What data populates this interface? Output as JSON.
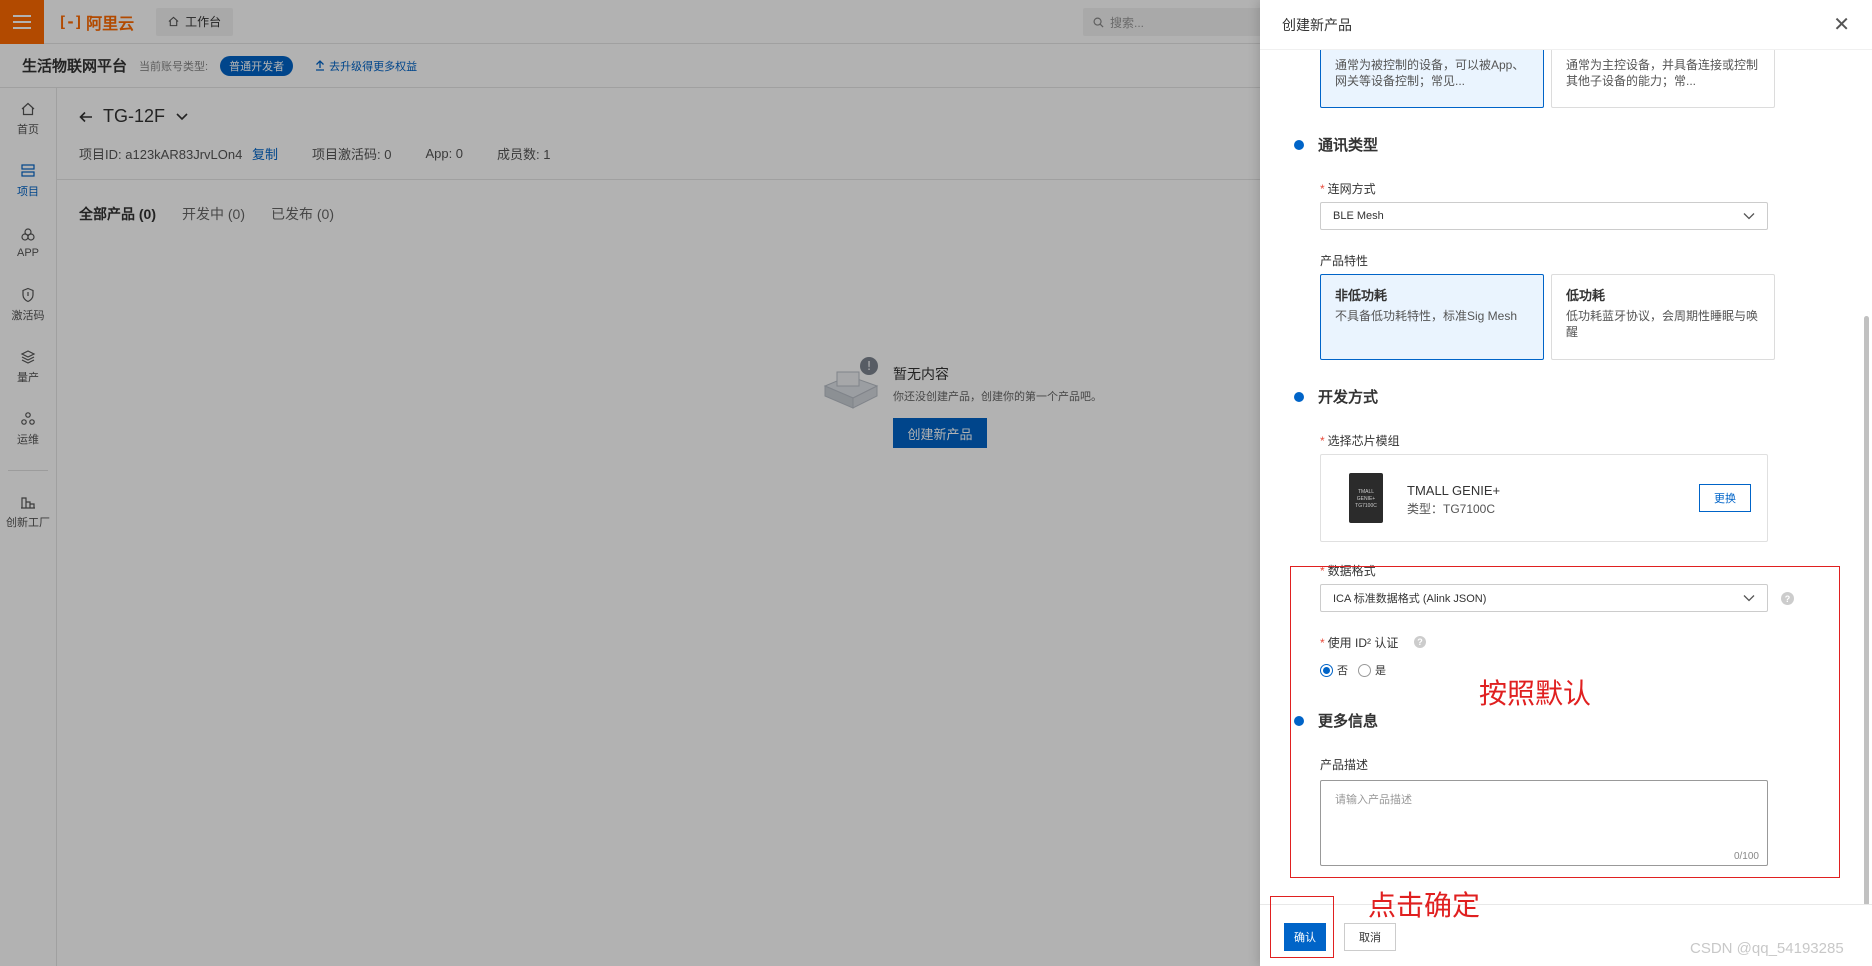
{
  "topbar": {
    "logo_text": "阿里云",
    "workbench_label": "工作台",
    "search_placeholder": "搜索..."
  },
  "subbar": {
    "platform_name": "生活物联网平台",
    "account_type_label": "当前账号类型:",
    "developer_badge": "普通开发者",
    "upgrade_link": "去升级得更多权益"
  },
  "sidebar": {
    "items": [
      {
        "label": "首页",
        "icon": "home-icon"
      },
      {
        "label": "项目",
        "icon": "project-icon"
      },
      {
        "label": "APP",
        "icon": "app-icon"
      },
      {
        "label": "激活码",
        "icon": "activation-icon"
      },
      {
        "label": "量产",
        "icon": "production-icon"
      },
      {
        "label": "运维",
        "icon": "ops-icon"
      },
      {
        "label": "创新工厂",
        "icon": "factory-icon"
      }
    ]
  },
  "project": {
    "name": "TG-12F",
    "id_label": "项目ID:",
    "id_value": "a123kAR83JrvLOn4",
    "copy_label": "复制",
    "activation_code": "项目激活码: 0",
    "app_count": "App: 0",
    "member_count": "成员数: 1"
  },
  "tabs": [
    {
      "label": "全部产品 (0)",
      "active": true
    },
    {
      "label": "开发中 (0)",
      "active": false
    },
    {
      "label": "已发布 (0)",
      "active": false
    }
  ],
  "empty_state": {
    "title": "暂无内容",
    "description": "你还没创建产品，创建你的第一个产品吧。",
    "button": "创建新产品"
  },
  "drawer": {
    "title": "创建新产品",
    "node_type": {
      "options": [
        {
          "desc": "通常为被控制的设备，可以被App、网关等设备控制；常见...",
          "selected": true
        },
        {
          "desc": "通常为主控设备，并具备连接或控制其他子设备的能力；常...",
          "selected": false
        }
      ]
    },
    "comm_section": {
      "title": "通讯类型",
      "network_label": "连网方式",
      "network_value": "BLE Mesh",
      "feature_label": "产品特性",
      "features": [
        {
          "title": "非低功耗",
          "desc": "不具备低功耗特性，标准Sig Mesh",
          "selected": true
        },
        {
          "title": "低功耗",
          "desc": "低功耗蓝牙协议，会周期性睡眠与唤醒",
          "selected": false
        }
      ]
    },
    "dev_section": {
      "title": "开发方式",
      "chip_label": "选择芯片模组",
      "chip_name": "TMALL GENIE+",
      "chip_type": "类型：TG7100C",
      "chip_img_text": "TMALL GENIE+ TG7100C",
      "change_button": "更换",
      "data_format_label": "数据格式",
      "data_format_value": "ICA 标准数据格式 (Alink JSON)",
      "id2_label": "使用 ID² 认证",
      "id2_options": [
        {
          "label": "否",
          "checked": true
        },
        {
          "label": "是",
          "checked": false
        }
      ]
    },
    "more_section": {
      "title": "更多信息",
      "desc_label": "产品描述",
      "desc_placeholder": "请输入产品描述",
      "desc_counter": "0/100"
    },
    "footer": {
      "confirm": "确认",
      "cancel": "取消"
    }
  },
  "annotations": {
    "default_note": "按照默认",
    "click_note": "点击确定",
    "color": "#e02020"
  },
  "watermark": "CSDN @qq_54193285"
}
